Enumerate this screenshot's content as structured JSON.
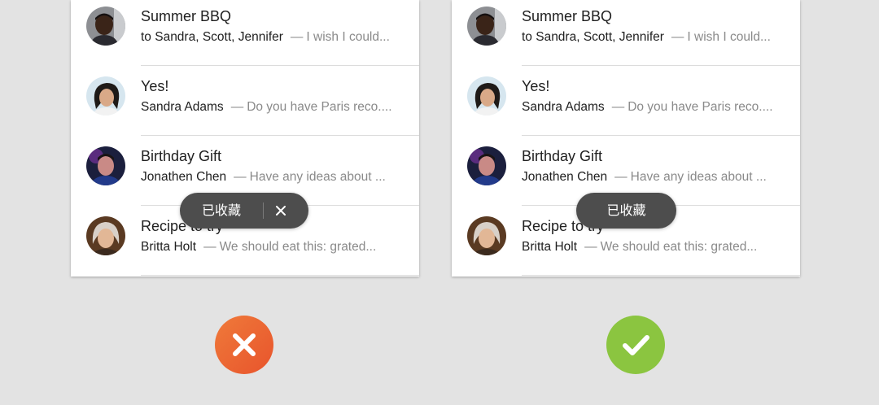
{
  "colors": {
    "background": "#e3e3e3",
    "card": "#ffffff",
    "snackbar": "#4d4d4d",
    "bad_badge": "#e8542c",
    "good_badge": "#8bc540",
    "preview_text": "#8a8a8a"
  },
  "emails": [
    {
      "subject": "Summer BBQ",
      "sender": "to Sandra, Scott, Jennifer",
      "separator": "—",
      "preview": "I wish I could...",
      "avatar": "avatar-summer-bbq"
    },
    {
      "subject": "Yes!",
      "sender": "Sandra Adams",
      "separator": "—",
      "preview": "Do you have Paris reco....",
      "avatar": "avatar-sandra-adams"
    },
    {
      "subject": "Birthday Gift",
      "sender": "Jonathen Chen",
      "separator": "—",
      "preview": "Have any ideas about ...",
      "avatar": "avatar-jonathen-chen"
    },
    {
      "subject": "Recipe to try",
      "sender": "Britta Holt",
      "separator": "—",
      "preview": "We should eat this: grated...",
      "avatar": "avatar-britta-holt"
    }
  ],
  "snackbar_bad": {
    "label": "已收藏",
    "action_icon": "close-icon"
  },
  "snackbar_good": {
    "label": "已收藏"
  },
  "verdicts": {
    "bad_icon": "cross-icon",
    "good_icon": "check-icon"
  }
}
